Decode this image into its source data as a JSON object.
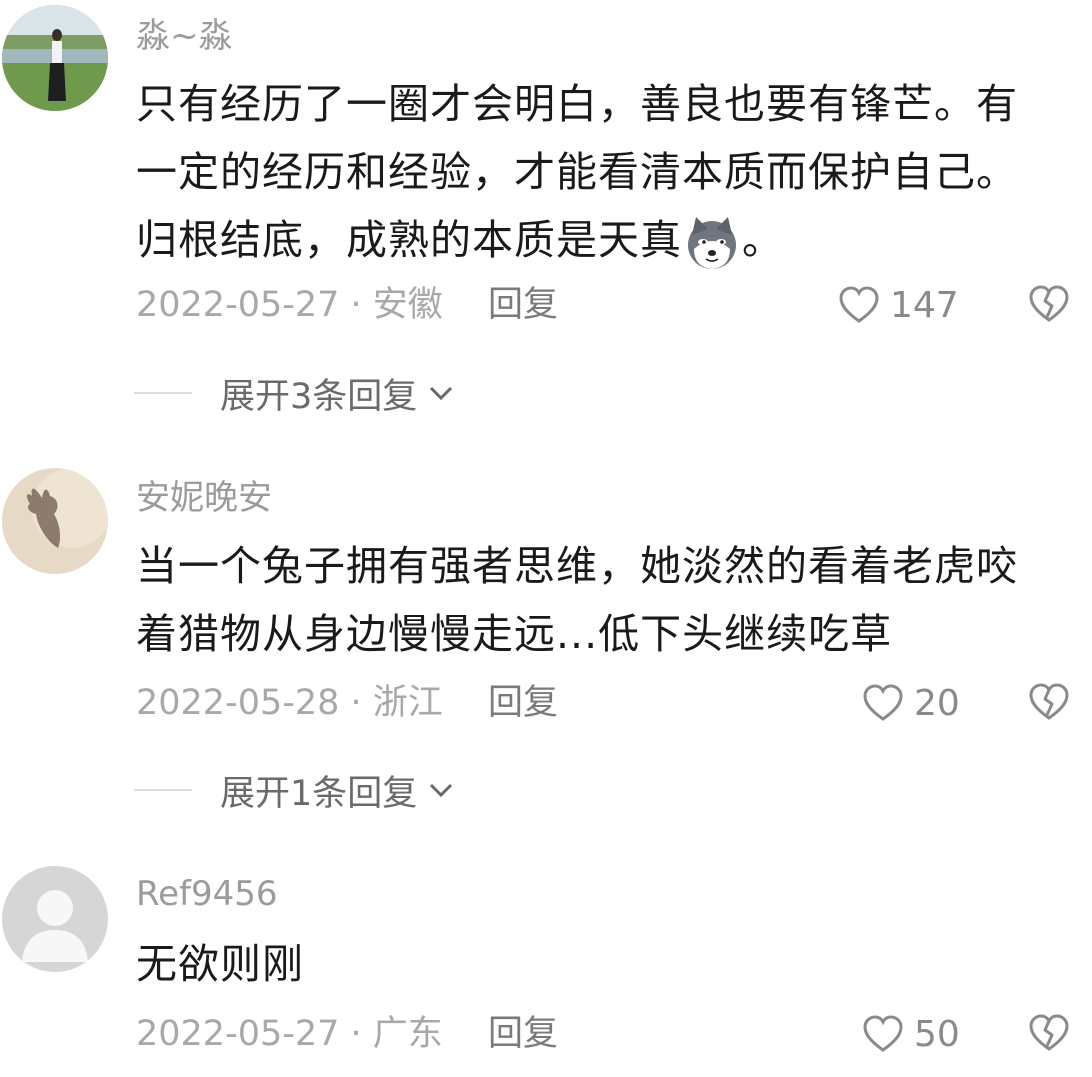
{
  "comments": [
    {
      "username": "淼~淼",
      "lines": [
        "只有经历了一圈才会明白，善良也要有锋芒。有",
        "一定的经历和经验，才能看清本质而保护自己。",
        "归根结底，成熟的本质是天真"
      ],
      "trailing": "。",
      "emoji": "husky-dog-emoji",
      "date_location": "2022-05-27 · 安徽",
      "reply_label": "回复",
      "likes": "147",
      "expand_label": "展开3条回复",
      "avatar": "photo-avatar-person-grassland"
    },
    {
      "username": "安妮晚安",
      "lines": [
        "当一个兔子拥有强者思维，她淡然的看着老虎咬",
        "着猎物从身边慢慢走远...低下头继续吃草"
      ],
      "date_location": "2022-05-28 · 浙江",
      "reply_label": "回复",
      "likes": "20",
      "expand_label": "展开1条回复",
      "avatar": "photo-avatar-hand-shadow"
    },
    {
      "username": "Ref9456",
      "lines": [
        "无欲则刚"
      ],
      "date_location": "2022-05-27 · 广东",
      "reply_label": "回复",
      "likes": "50",
      "avatar": "default-avatar-person"
    }
  ],
  "icons": {
    "like": "heart-outline-icon",
    "dislike": "broken-heart-icon",
    "expand": "chevron-down-icon"
  },
  "colors": {
    "text": "#1a1a1a",
    "username": "#9b9b9b",
    "meta": "#a8a8a8",
    "icon": "#8a8a8a"
  }
}
